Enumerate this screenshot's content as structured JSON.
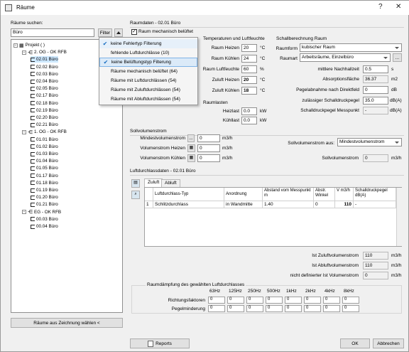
{
  "window": {
    "title": "Räume",
    "help": "?",
    "close": "✕"
  },
  "left": {
    "search_label": "Räume suchen:",
    "search_value": "Büro",
    "filter_btn": "Filter",
    "bottom_btn": "Räume aus Zeichnung wählen <",
    "tree": [
      {
        "label": "Projekt ( )",
        "level": 0,
        "type": "project"
      },
      {
        "label": "2. OG - OK RFB",
        "level": 1,
        "type": "floor"
      },
      {
        "label": "02.01 Büro",
        "level": 2,
        "type": "room",
        "selected": true
      },
      {
        "label": "02.02 Büro",
        "level": 2,
        "type": "room"
      },
      {
        "label": "02.03 Büro",
        "level": 2,
        "type": "room"
      },
      {
        "label": "02.04 Büro",
        "level": 2,
        "type": "room"
      },
      {
        "label": "02.05 Büro",
        "level": 2,
        "type": "room"
      },
      {
        "label": "02.17 Büro",
        "level": 2,
        "type": "room"
      },
      {
        "label": "02.18 Büro",
        "level": 2,
        "type": "room"
      },
      {
        "label": "02.19 Büro",
        "level": 2,
        "type": "room"
      },
      {
        "label": "02.20 Büro",
        "level": 2,
        "type": "room"
      },
      {
        "label": "02.21 Büro",
        "level": 2,
        "type": "room"
      },
      {
        "label": "1. OG - OK RFB",
        "level": 1,
        "type": "floor"
      },
      {
        "label": "01.01 Büro",
        "level": 2,
        "type": "room"
      },
      {
        "label": "01.02 Büro",
        "level": 2,
        "type": "room"
      },
      {
        "label": "01.03 Büro",
        "level": 2,
        "type": "room"
      },
      {
        "label": "01.04 Büro",
        "level": 2,
        "type": "room"
      },
      {
        "label": "01.05 Büro",
        "level": 2,
        "type": "room"
      },
      {
        "label": "01.17 Büro",
        "level": 2,
        "type": "room"
      },
      {
        "label": "01.18 Büro",
        "level": 2,
        "type": "room"
      },
      {
        "label": "01.19 Büro",
        "level": 2,
        "type": "room"
      },
      {
        "label": "01.20 Büro",
        "level": 2,
        "type": "room"
      },
      {
        "label": "01.21 Büro",
        "level": 2,
        "type": "room"
      },
      {
        "label": "EG - OK RFB",
        "level": 1,
        "type": "floor"
      },
      {
        "label": "00.03 Büro",
        "level": 2,
        "type": "room"
      },
      {
        "label": "00.04 Büro",
        "level": 2,
        "type": "room"
      }
    ]
  },
  "filter_menu": [
    {
      "label": "keine Fehlertyp Filterung",
      "checked": true
    },
    {
      "label": "fehlende Luftdurchlässe (10)",
      "checked": false
    },
    {
      "label": "keine Belüftungstyp Filterung",
      "checked": true
    },
    {
      "label": "Räume mechanisch belüftet (64)",
      "checked": false
    },
    {
      "label": "Räume mit Luftdurchlässen (54)",
      "checked": false
    },
    {
      "label": "Räume mit Zuluftdurchlässen (54)",
      "checked": false
    },
    {
      "label": "Räume mit Abluftdurchlässen (54)",
      "checked": false
    }
  ],
  "raumdaten": {
    "title": "Raumdaten - 02.01 Büro",
    "mech_checkbox": "Raum mechanisch belüftet",
    "temp_title": "Temperaturen und Luftfeuchte",
    "raum_heizen": {
      "label": "Raum Heizen",
      "value": "20",
      "unit": "°C"
    },
    "raum_kuehlen": {
      "label": "Raum Kühlen",
      "value": "24",
      "unit": "°C"
    },
    "raum_feuchte": {
      "label": "Raum Luftfeuchte",
      "value": "60",
      "unit": "%"
    },
    "zuluft_heizen": {
      "label": "Zuluft Heizen",
      "value": "20",
      "unit": "°C"
    },
    "zuluft_kuehlen": {
      "label": "Zuluft Kühlen",
      "value": "18",
      "unit": "°C"
    },
    "raumlasten_title": "Raumlasten",
    "heizlast": {
      "label": "Heizlast",
      "value": "0.0",
      "unit": "kW"
    },
    "kuehllast": {
      "label": "Kühllast",
      "value": "0.0",
      "unit": "kW"
    },
    "schall_title": "Schallberechnung Raum",
    "raumform": {
      "label": "Raumform",
      "value": "kubischer Raum"
    },
    "raumart": {
      "label": "Raumart",
      "value": "Arbeitsräume, Einzelbüro",
      "btn": "..."
    },
    "nachhall": {
      "label": "mittlere Nachhallzeit",
      "value": "0.5",
      "unit": "s"
    },
    "absorption": {
      "label": "Absorptionsfläche",
      "value": "36.37",
      "unit": "m2"
    },
    "pegelabnahme": {
      "label": "Pegelabnahme nach Direktfeld",
      "value": "0",
      "unit": "dB"
    },
    "zul_schall": {
      "label": "zulässiger Schalldruckpegel",
      "value": "35.0",
      "unit": "dB(A)"
    },
    "schall_mess": {
      "label": "Schalldruckpegel Messpunkt",
      "value": "-",
      "unit": "dB(A)"
    }
  },
  "soll": {
    "title": "Sollvolumenstrom",
    "min": {
      "label": "Mindestvolumenstrom",
      "value": "0",
      "unit": "m3/h",
      "btn": "..."
    },
    "heizen": {
      "label": "Volumenstrom Heizen",
      "value": "0",
      "unit": "m3/h"
    },
    "kuehlen": {
      "label": "Volumenstrom Kühlen",
      "value": "0",
      "unit": "m3/h"
    },
    "aus": {
      "label": "Sollvolumenstrom aus:",
      "value": "Mindestvolumenstrom"
    },
    "soll": {
      "label": "Sollvolumenstrom",
      "value": "0",
      "unit": "m3/h"
    }
  },
  "luft": {
    "title": "Luftdurchlassdaten - 02.01 Büro",
    "tabs": [
      "Zuluft",
      "Abluft"
    ],
    "headers": [
      "Luftdurchlass-Typ",
      "Anordnung",
      "Abstand vom Messpunkt m",
      "Abstr. Winkel",
      "V m3/h",
      "Schalldruckpegel dB(A)"
    ],
    "row": {
      "nr": "1",
      "typ": "Schlitzdurchlass",
      "anordnung": "in Wandmitte",
      "abstand": "1.40",
      "winkel": "0",
      "v": "110",
      "pegel": "-"
    },
    "ist_zu": {
      "label": "Ist Zuluftvolumenstrom",
      "value": "110",
      "unit": "m3/h"
    },
    "ist_ab": {
      "label": "Ist Abluftvolumenstrom",
      "value": "110",
      "unit": "m3/h"
    },
    "ist_nd": {
      "label": "nicht definierter Ist Volumenstrom",
      "value": "0",
      "unit": "m3/h"
    },
    "daempf_title": "Raumdämpfung des gewählten Luftdurchlasses",
    "freqs": [
      "63Hz",
      "125Hz",
      "250Hz",
      "500Hz",
      "1kHz",
      "2kHz",
      "4kHz",
      "8kHz"
    ],
    "richt_label": "Richtungsfaktoren",
    "richt_values": [
      "0",
      "0",
      "0",
      "0",
      "0",
      "0",
      "0",
      "0"
    ],
    "pegel_label": "Pegelminderung",
    "pegel_values": [
      "0",
      "0",
      "0",
      "0",
      "0",
      "0",
      "0",
      "0"
    ]
  },
  "footer": {
    "reports": "Reports",
    "ok": "OK",
    "cancel": "Abbrechen"
  }
}
